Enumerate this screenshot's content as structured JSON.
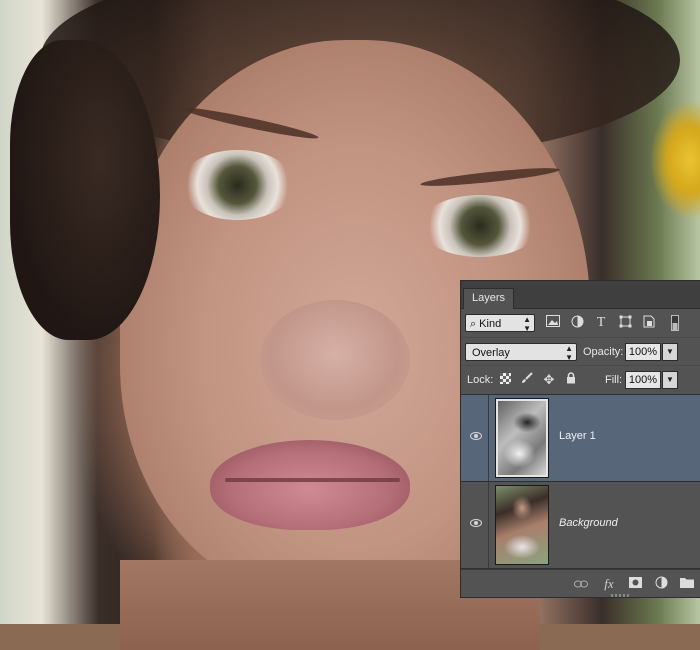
{
  "panel": {
    "tab_label": "Layers",
    "filter": {
      "kind_label": "Kind",
      "search_glyph": "⌕"
    },
    "filter_icons": [
      "image-filter-icon",
      "adjustment-filter-icon",
      "type-filter-icon",
      "shape-filter-icon",
      "smart-object-filter-icon",
      "filter-toggle-icon"
    ],
    "blend": {
      "mode": "Overlay",
      "opacity_label": "Opacity:",
      "opacity_value": "100%"
    },
    "lock": {
      "label": "Lock:",
      "fill_label": "Fill:",
      "fill_value": "100%"
    },
    "layers": [
      {
        "name": "Layer 1",
        "selected": true,
        "visible": true
      },
      {
        "name": "Background",
        "selected": false,
        "visible": true
      }
    ],
    "footer_icons": [
      "link-layers-icon",
      "fx-icon",
      "add-mask-icon",
      "adjustment-layer-icon",
      "new-group-icon"
    ]
  },
  "colors": {
    "panel_bg": "#535353",
    "selected_row": "#58667a",
    "tab_bar": "#3f3f3f"
  }
}
